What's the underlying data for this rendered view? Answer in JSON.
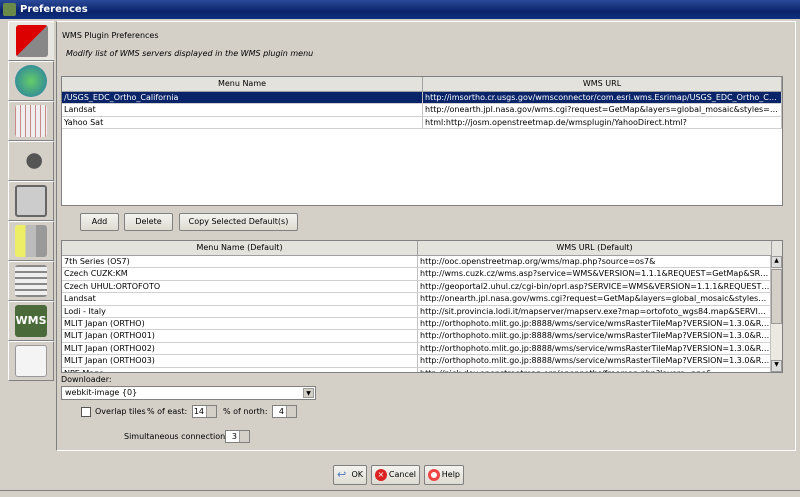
{
  "window": {
    "title": "Preferences"
  },
  "sidebar": {
    "tabs": [
      {
        "name": "display"
      },
      {
        "name": "map"
      },
      {
        "name": "projection"
      },
      {
        "name": "audio"
      },
      {
        "name": "connection"
      },
      {
        "name": "plugins"
      },
      {
        "name": "shortcuts"
      },
      {
        "name": "wms",
        "label": "WMS"
      },
      {
        "name": "advanced"
      }
    ]
  },
  "header": {
    "title": "WMS Plugin Preferences",
    "description": "Modify list of WMS servers displayed in the WMS plugin menu"
  },
  "user_table": {
    "columns": [
      "Menu Name",
      "WMS URL"
    ],
    "rows": [
      [
        "/USGS_EDC_Ortho_California",
        "http://imsortho.cr.usgs.gov/wmsconnector/com.esri.wms.Esrimap/USGS_EDC_Ortho_Californ..."
      ],
      [
        "Landsat",
        "http://onearth.jpl.nasa.gov/wms.cgi?request=GetMap&layers=global_mosaic&styles=&forma..."
      ],
      [
        "Yahoo Sat",
        "html:http://josm.openstreetmap.de/wmsplugin/YahooDirect.html?"
      ]
    ]
  },
  "buttons": {
    "add": "Add",
    "delete": "Delete",
    "copy": "Copy Selected Default(s)"
  },
  "default_table": {
    "columns": [
      "Menu Name (Default)",
      "WMS URL (Default)"
    ],
    "rows": [
      [
        "7th Series (OS7)",
        "http://ooc.openstreetmap.org/wms/map.php?source=os7&"
      ],
      [
        "Czech CUZK:KM",
        "http://wms.cuzk.cz/wms.asp?service=WMS&VERSION=1.1.1&REQUEST=GetMap&SRS=EP..."
      ],
      [
        "Czech UHUL:ORTOFOTO",
        "http://geoportal2.uhul.cz/cgi-bin/oprl.asp?SERVICE=WMS&VERSION=1.1.1&REQUEST=Get..."
      ],
      [
        "Landsat",
        "http://onearth.jpl.nasa.gov/wms.cgi?request=GetMap&layers=global_mosaic&styles=&for..."
      ],
      [
        "Lodi - Italy",
        "http://sit.provincia.lodi.it/mapserver/mapserv.exe?map=ortofoto_wgs84.map&SERVICE=W..."
      ],
      [
        "MLIT Japan (ORTHO)",
        "http://orthophoto.mlit.go.jp:8888/wms/service/wmsRasterTileMap?VERSION=1.3.0&REQUE..."
      ],
      [
        "MLIT Japan (ORTHO01)",
        "http://orthophoto.mlit.go.jp:8888/wms/service/wmsRasterTileMap?VERSION=1.3.0&REQUE..."
      ],
      [
        "MLIT Japan (ORTHO02)",
        "http://orthophoto.mlit.go.jp:8888/wms/service/wmsRasterTileMap?VERSION=1.3.0&REQUE..."
      ],
      [
        "MLIT Japan (ORTHO03)",
        "http://orthophoto.mlit.go.jp:8888/wms/service/wmsRasterTileMap?VERSION=1.3.0&REQUE..."
      ],
      [
        "NPE Maps",
        "http://nick.dev.openstreetmap.org/openpaths/freemap.php?layers=npe&"
      ]
    ]
  },
  "downloader": {
    "label": "Downloader:",
    "value": "webkit-image {0}"
  },
  "overlap": {
    "label": "Overlap tiles",
    "checked": false,
    "east_label": "% of east:",
    "east": "14",
    "north_label": "% of north:",
    "north": "4"
  },
  "connections": {
    "label": "Simultaneous connections",
    "value": "3"
  },
  "footer": {
    "ok": "OK",
    "cancel": "Cancel",
    "help": "Help"
  }
}
